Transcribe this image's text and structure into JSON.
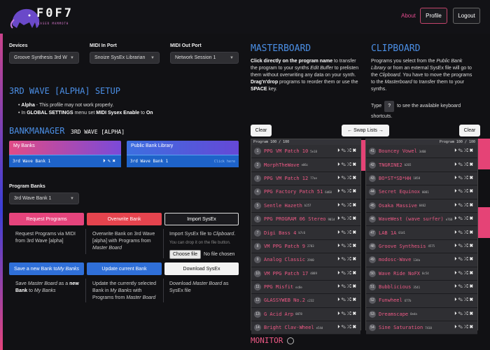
{
  "brand": {
    "name": "F0F7",
    "tagline": "LASER MAMMOTH"
  },
  "nav": {
    "about": "About",
    "profile": "Profile",
    "logout": "Logout"
  },
  "devices": {
    "label": "Devices",
    "value": "Groove Synthesis 3rd W"
  },
  "midi_in": {
    "label": "MIDI In Port",
    "value": "Snoize SysEx Librarian"
  },
  "midi_out": {
    "label": "MIDI Out Port",
    "value": "Network Session 1"
  },
  "setup": {
    "title": "3RD WAVE [ALPHA] SETUP",
    "alpha_bold": "Alpha",
    "alpha_text": " - This profile may not work properly.",
    "settings_pre": "In ",
    "settings_bold": "GLOBAL SETTINGS",
    "settings_mid": " menu set ",
    "settings_bold2": "MIDI Sysex Enable",
    "settings_to": " to ",
    "settings_on": "On"
  },
  "bankmanager": {
    "title": "BANKMANAGER",
    "subtitle": "3RD WAVE [ALPHA]",
    "my_banks": {
      "label": "My Banks",
      "bank": "3rd Wave Bank 1"
    },
    "public": {
      "label": "Public Bank Library",
      "bank": "3rd Wave Bank 1",
      "hint": "Click here"
    }
  },
  "program_banks": {
    "label": "Program Banks",
    "value": "3rd Wave Bank 1"
  },
  "actions": {
    "request": "Request Programs",
    "overwrite": "Overwrite Bank",
    "import": "Import SysEx",
    "save_pre": "Save a new Bank to ",
    "save_em": "My Banks",
    "update": "Update current Bank",
    "download": "Download SysEx"
  },
  "descriptions": {
    "request": "Request Programs via MIDI from 3rd Wave [alpha]",
    "overwrite_1": "Overwrite Bank on 3rd Wave [alpha] with Programs from ",
    "overwrite_em": "Master Board",
    "import_1": "Import SysEx file to ",
    "import_em": "Clipboard",
    "import_2": ".",
    "import_drop": "You can drop it on the file button.",
    "file_button": "Choose file",
    "file_none": "No file chosen",
    "save_1": "Save ",
    "save_em1": "Master Board",
    "save_2": " as a ",
    "save_b": "new Bank",
    "save_3": " to ",
    "save_em2": "My Banks",
    "update_1": "Update the currently selected Bank in ",
    "update_em1": "My Banks",
    "update_2": " with Programs from ",
    "update_em2": "Master Board",
    "download_1": "Download ",
    "download_em": "Master Board",
    "download_2": " as SysEx file"
  },
  "masterboard": {
    "title": "MASTERBOARD",
    "text_b1": "Click directly on the program name",
    "text_1": " to transfer the program to your synths ",
    "text_em1": "Edit Buffer",
    "text_2": " to prelisten them without overwriting any data on your synth. ",
    "text_b2": "Drag'n'drop",
    "text_3": " programs to reorder them or use the ",
    "text_b3": "SPACE",
    "text_4": " key."
  },
  "clipboard": {
    "title": "CLIPBOARD",
    "text_1": "Programs you select from the ",
    "text_em1": "Public Bank Library",
    "text_2": " or from an external SysEx file will go to the ",
    "text_em2": "Clipboard",
    "text_3": ". You have to move the programs to the ",
    "text_em3": "Masterboard",
    "text_4": " to transfer them to your synths.",
    "type_1": "Type",
    "type_key": "?",
    "type_2": "to see the available keyboard shortcuts."
  },
  "toolbar": {
    "clear_left": "Clear",
    "swap": "← Swap Lists →",
    "clear_right": "Clear"
  },
  "master_list": {
    "header_left": "Program 100 / 100",
    "items": [
      {
        "n": "1",
        "name": "PPG VM Patch 10",
        "hex": "5e18"
      },
      {
        "n": "2",
        "name": "MorphTheWave",
        "hex": "e06c"
      },
      {
        "n": "3",
        "name": "PPG VM Patch 12",
        "hex": "77ae"
      },
      {
        "n": "4",
        "name": "PPG Factory Patch 51",
        "hex": "6d60"
      },
      {
        "n": "5",
        "name": "Sentle Hazeth",
        "hex": "b257"
      },
      {
        "n": "6",
        "name": "PPG PROGRAM 06 Stereo",
        "hex": "901d"
      },
      {
        "n": "7",
        "name": "Digi Bass 4",
        "hex": "b7c6"
      },
      {
        "n": "8",
        "name": "VM PPG Patch 9",
        "hex": "2783"
      },
      {
        "n": "9",
        "name": "Analog Classic",
        "hex": "2940"
      },
      {
        "n": "10",
        "name": "VM PPG Patch 17",
        "hex": "4889"
      },
      {
        "n": "11",
        "name": "PPG Misfit",
        "hex": "ec8e"
      },
      {
        "n": "12",
        "name": "GLASSYWEB No.2",
        "hex": "c232"
      },
      {
        "n": "13",
        "name": "G Acid Arp",
        "hex": "0078"
      },
      {
        "n": "14",
        "name": "Bright Clav-Wheel",
        "hex": "e54d"
      }
    ]
  },
  "clip_list": {
    "header_right": "Program 100 / 100",
    "items": [
      {
        "n": "41",
        "name": "Bouncey Vowel",
        "hex": "3d60"
      },
      {
        "n": "42",
        "name": "TNGRINE2",
        "hex": "b265"
      },
      {
        "n": "43",
        "name": "BO*ST*SD*HH",
        "hex": "1858"
      },
      {
        "n": "44",
        "name": "Secret Equinox",
        "hex": "0081"
      },
      {
        "n": "45",
        "name": "Osaka Massive",
        "hex": "8462"
      },
      {
        "n": "46",
        "name": "WaveWest (wave surfer)",
        "hex": "e760"
      },
      {
        "n": "47",
        "name": "LAB 1A",
        "hex": "01d1"
      },
      {
        "n": "48",
        "name": "Groove Synthesis",
        "hex": "4575"
      },
      {
        "n": "49",
        "name": "modosc-Wave",
        "hex": "13da"
      },
      {
        "n": "50",
        "name": "Wave Ride NoFX",
        "hex": "0c54"
      },
      {
        "n": "51",
        "name": "Bubblicious",
        "hex": "3541"
      },
      {
        "n": "52",
        "name": "Funwheel",
        "hex": "677b"
      },
      {
        "n": "53",
        "name": "Dreamscape",
        "hex": "0eda"
      },
      {
        "n": "54",
        "name": "Sine Saturation",
        "hex": "7410"
      }
    ]
  },
  "monitor": {
    "title": "MONITOR"
  },
  "colors": {
    "accent_pink": "#e5447c",
    "accent_blue": "#2f6fd8",
    "program_name": "#ef5a86"
  }
}
